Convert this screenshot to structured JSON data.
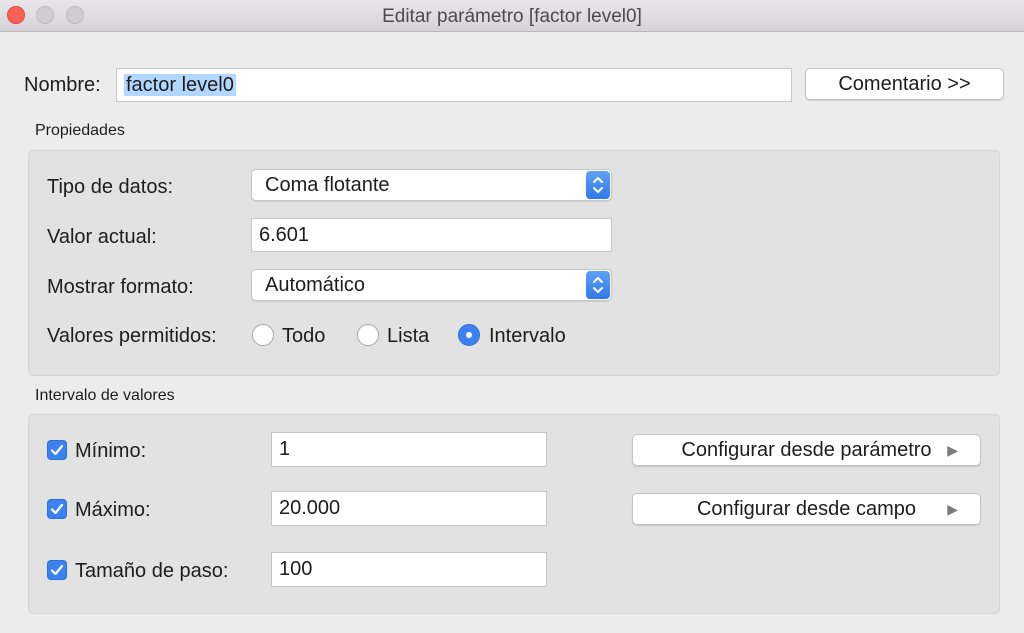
{
  "window": {
    "title": "Editar parámetro [factor level0]"
  },
  "name_row": {
    "label": "Nombre:",
    "value": "factor level0",
    "comment_button": "Comentario >>"
  },
  "properties": {
    "section_title": "Propiedades",
    "data_type_label": "Tipo de datos:",
    "data_type_value": "Coma flotante",
    "current_value_label": "Valor actual:",
    "current_value": "6.601",
    "display_format_label": "Mostrar formato:",
    "display_format_value": "Automático",
    "allowed_values_label": "Valores permitidos:",
    "allowed_options": [
      {
        "label": "Todo",
        "selected": false
      },
      {
        "label": "Lista",
        "selected": false
      },
      {
        "label": "Intervalo",
        "selected": true
      }
    ]
  },
  "range": {
    "section_title": "Intervalo de valores",
    "min_label": "Mínimo:",
    "min_value": "1",
    "min_checked": true,
    "max_label": "Máximo:",
    "max_value": "20.000",
    "max_checked": true,
    "step_label": "Tamaño de paso:",
    "step_value": "100",
    "step_checked": true,
    "set_from_parameter_button": "Configurar desde parámetro",
    "set_from_field_button": "Configurar desde campo"
  },
  "colors": {
    "accent": "#3b82f0",
    "close": "#fc5f57",
    "selection": "#b2d7ff"
  }
}
